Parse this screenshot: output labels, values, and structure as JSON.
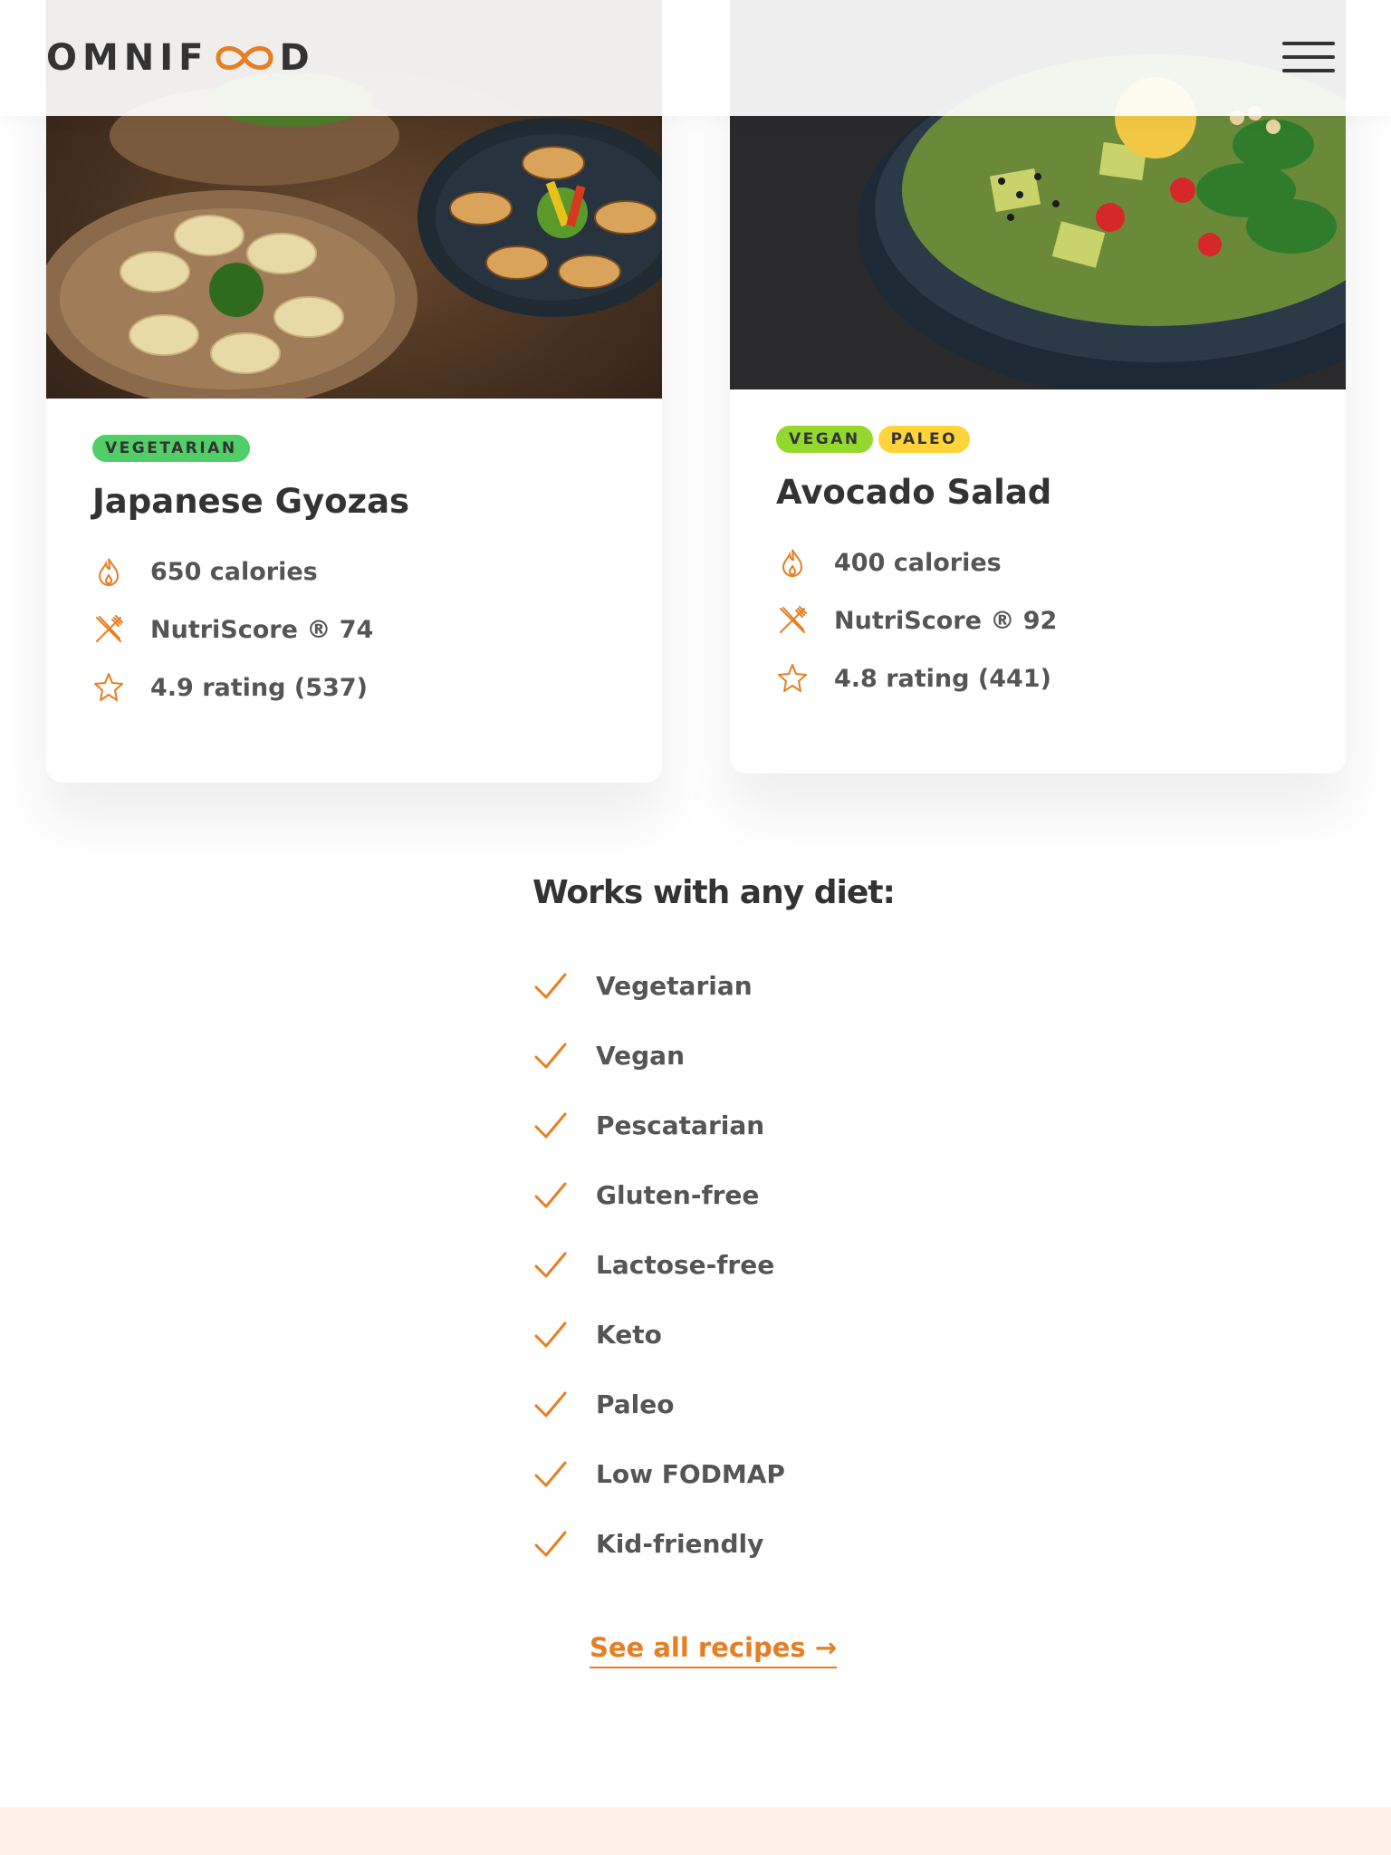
{
  "header": {
    "logo_prefix": "OMNIF",
    "logo_suffix": "D",
    "menu_icon": "hamburger-icon"
  },
  "colors": {
    "accent": "#e67e22",
    "text": "#333333",
    "vegetarian": "#51cf66",
    "vegan": "#94d82d",
    "paleo": "#ffd43b",
    "section_bg": "#fdf2e9"
  },
  "meals": [
    {
      "tags": [
        "Vegetarian"
      ],
      "title": "Japanese Gyozas",
      "calories": "650 calories",
      "nutriscore": "NutriScore ® 74",
      "rating": "4.9 rating (537)"
    },
    {
      "tags": [
        "Vegan",
        "Paleo"
      ],
      "title": "Avocado Salad",
      "calories": "400 calories",
      "nutriscore": "NutriScore ® 92",
      "rating": "4.8 rating (441)"
    }
  ],
  "diets": {
    "title": "Works with any diet:",
    "items": [
      "Vegetarian",
      "Vegan",
      "Pescatarian",
      "Gluten-free",
      "Lactose-free",
      "Keto",
      "Paleo",
      "Low FODMAP",
      "Kid-friendly"
    ]
  },
  "cta": {
    "see_all": "See all recipes →"
  }
}
